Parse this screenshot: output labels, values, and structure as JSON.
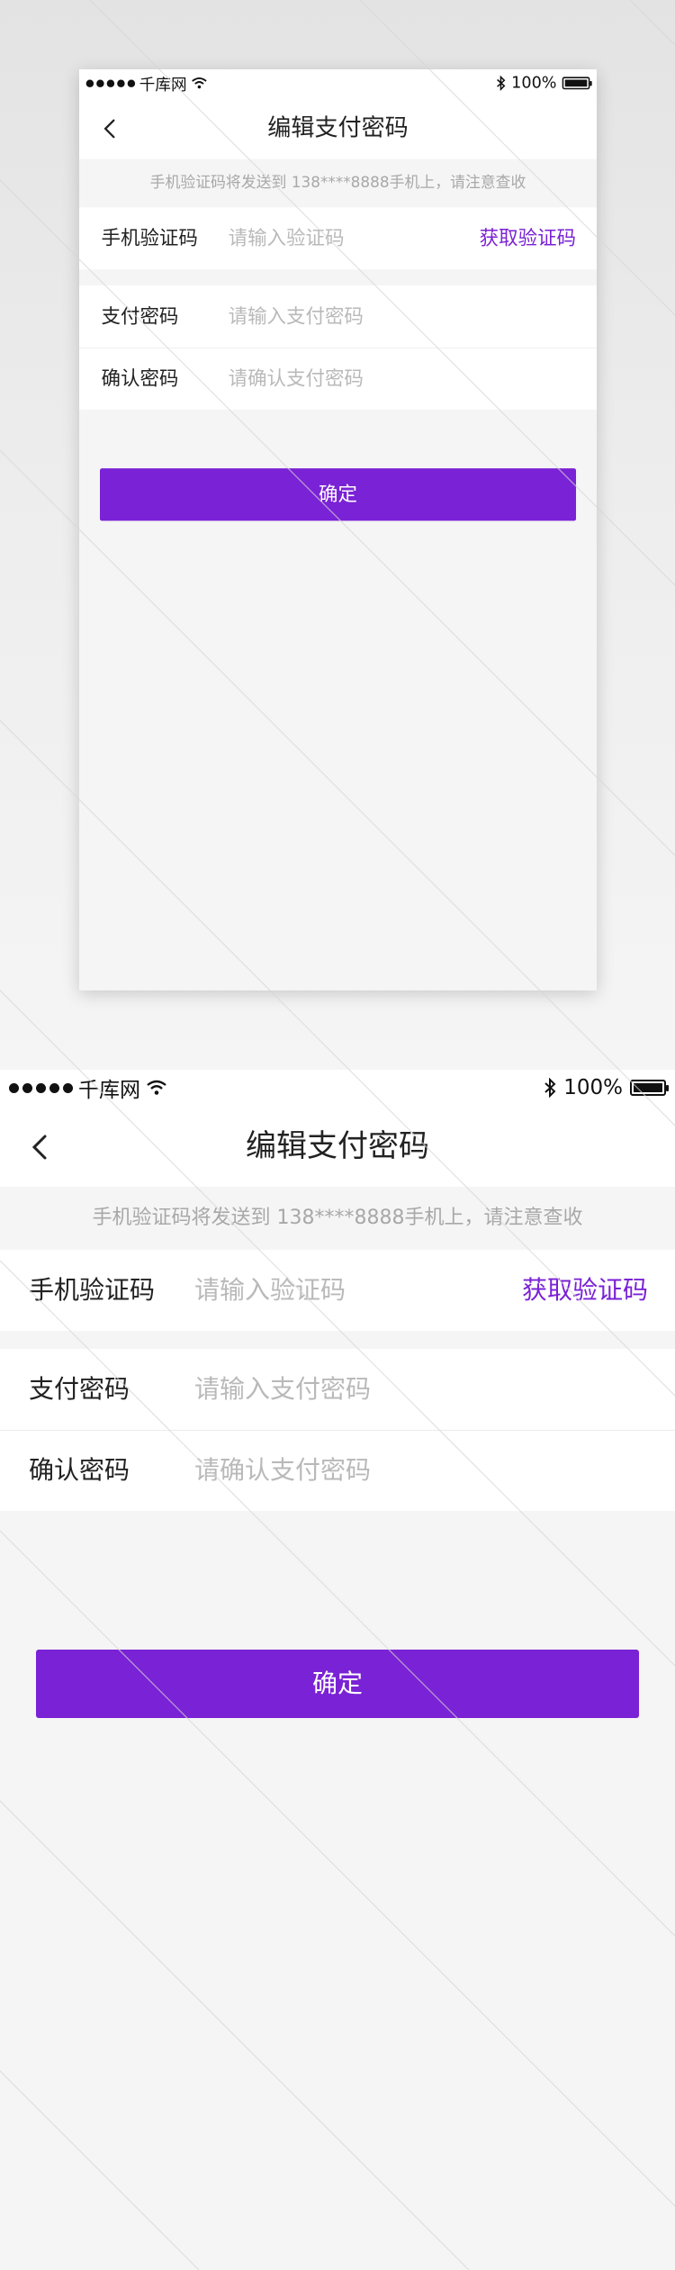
{
  "status_bar": {
    "carrier": "千库网",
    "battery": "100%",
    "battery_level": 1.0
  },
  "nav": {
    "title": "编辑支付密码"
  },
  "hint": "手机验证码将发送到 138****8888手机上，请注意查收",
  "form": {
    "code": {
      "label": "手机验证码",
      "placeholder": "请输入验证码",
      "action": "获取验证码"
    },
    "pay_password": {
      "label": "支付密码",
      "placeholder": "请输入支付密码"
    },
    "confirm_password": {
      "label": "确认密码",
      "placeholder": "请确认支付密码"
    }
  },
  "submit_label": "确定",
  "colors": {
    "accent": "#7a22d5",
    "background": "#f5f5f5",
    "text": "#222222",
    "placeholder": "#b9b9b9",
    "hint": "#a8a8a8"
  },
  "icons": [
    "back-icon",
    "wifi-icon",
    "bluetooth-icon",
    "battery-icon"
  ]
}
